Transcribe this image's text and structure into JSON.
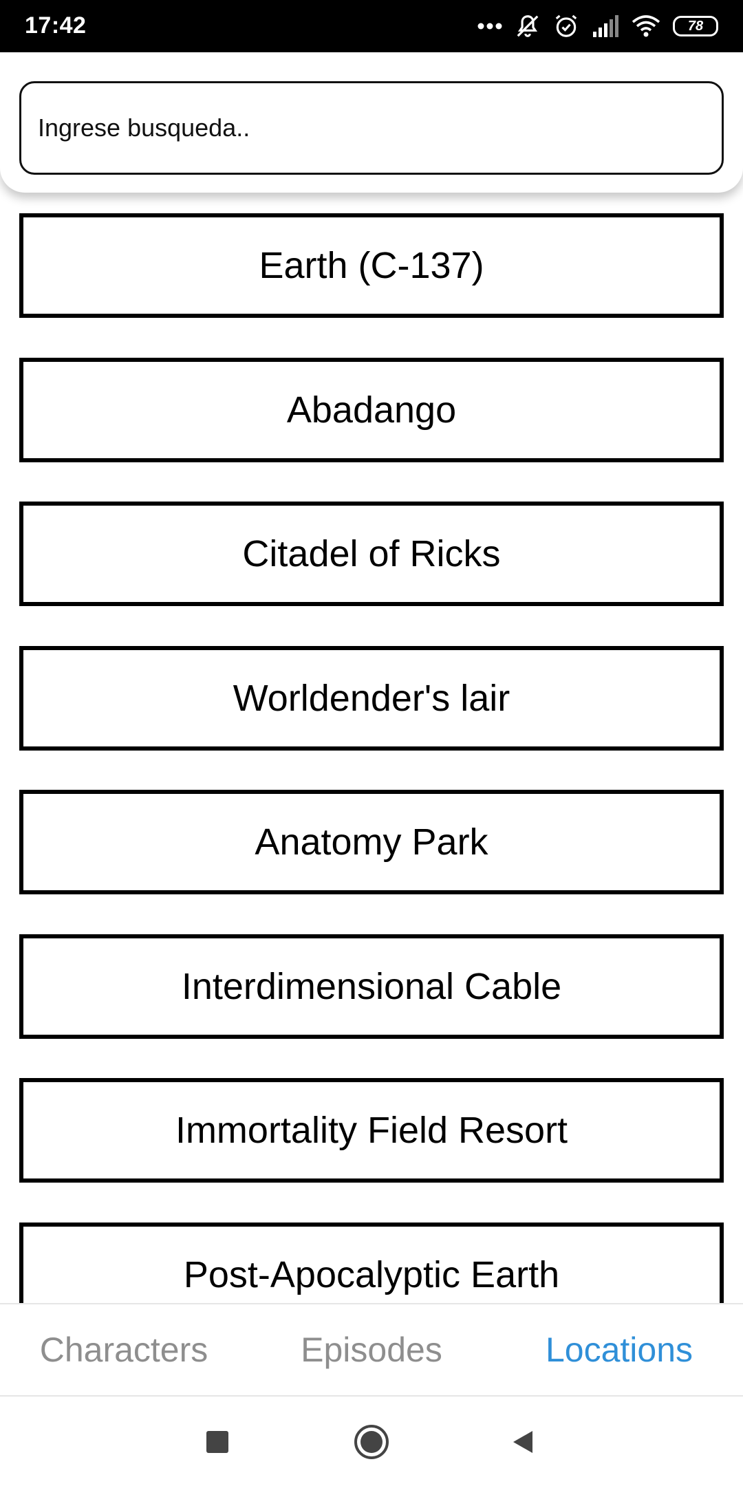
{
  "status_bar": {
    "time": "17:42",
    "battery_level": "78",
    "icons": [
      "more-dots-icon",
      "notifications-off-icon",
      "alarm-icon",
      "signal-icon",
      "wifi-icon",
      "battery-icon"
    ]
  },
  "search": {
    "placeholder": "Ingrese busqueda..",
    "value": ""
  },
  "locations": [
    "Earth (C-137)",
    "Abadango",
    "Citadel of Ricks",
    "Worldender's lair",
    "Anatomy Park",
    "Interdimensional Cable",
    "Immortality Field Resort",
    "Post-Apocalyptic Earth"
  ],
  "tabs": [
    {
      "label": "Characters",
      "active": false
    },
    {
      "label": "Episodes",
      "active": false
    },
    {
      "label": "Locations",
      "active": true
    }
  ],
  "nav_bar": {
    "icons": [
      "recent-apps-icon",
      "home-icon",
      "back-icon"
    ]
  },
  "colors": {
    "accent": "#2f8fd8",
    "inactive_tab": "#8e8e8e",
    "border": "#000000"
  }
}
